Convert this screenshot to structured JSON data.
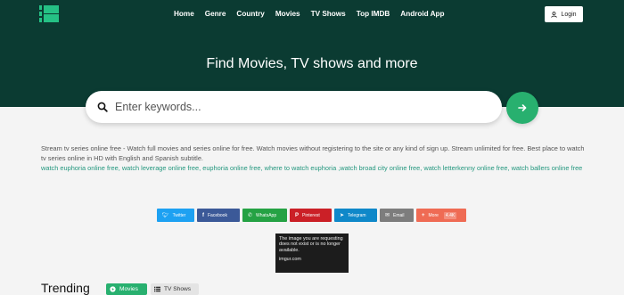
{
  "nav": {
    "items": [
      "Home",
      "Genre",
      "Country",
      "Movies",
      "TV Shows",
      "Top IMDB",
      "Android App"
    ]
  },
  "login": {
    "label": "Login",
    "icon": "user-icon"
  },
  "hero": {
    "headline": "Find Movies, TV shows and more"
  },
  "search": {
    "placeholder": "Enter keywords...",
    "icon": "search-icon",
    "submit_icon": "arrow-right-icon"
  },
  "description": {
    "text": "Stream tv series online free - Watch full movies and series online for free. Watch movies without registering to the site or any kind of sign up. Stream unlimited for free. Best place to watch tv series online in HD with English and Spanish subtitle.",
    "links": [
      "watch euphoria online free",
      "watch leverage online free",
      "euphoria online free",
      "where to watch euphoria",
      "watch broad city online free",
      "watch letterkenny online free",
      "watch ballers online free"
    ]
  },
  "share": [
    {
      "label": "Twitter",
      "color": "#1da1f2",
      "icon": "twitter-icon"
    },
    {
      "label": "Facebook",
      "color": "#3b5998",
      "icon": "facebook-icon"
    },
    {
      "label": "WhatsApp",
      "color": "#25a244",
      "icon": "whatsapp-icon"
    },
    {
      "label": "Pinterest",
      "color": "#cb2027",
      "icon": "pinterest-icon"
    },
    {
      "label": "Telegram",
      "color": "#0f88c9",
      "icon": "telegram-icon"
    },
    {
      "label": "Email",
      "color": "#7d7d7d",
      "icon": "email-icon"
    },
    {
      "label": "More",
      "color": "#ef6b54",
      "icon": "plus-icon",
      "count": "4.4K"
    }
  ],
  "image_placeholder": {
    "line1": "The image you are requesting does not exist or is no longer available.",
    "line2": "imgur.com"
  },
  "trending": {
    "title": "Trending",
    "tabs": [
      {
        "label": "Movies",
        "icon": "play-icon"
      },
      {
        "label": "TV Shows",
        "icon": "list-icon"
      }
    ]
  },
  "colors": {
    "hero_bg": "#0b3b32",
    "accent": "#28b06f",
    "link": "#23977e"
  }
}
